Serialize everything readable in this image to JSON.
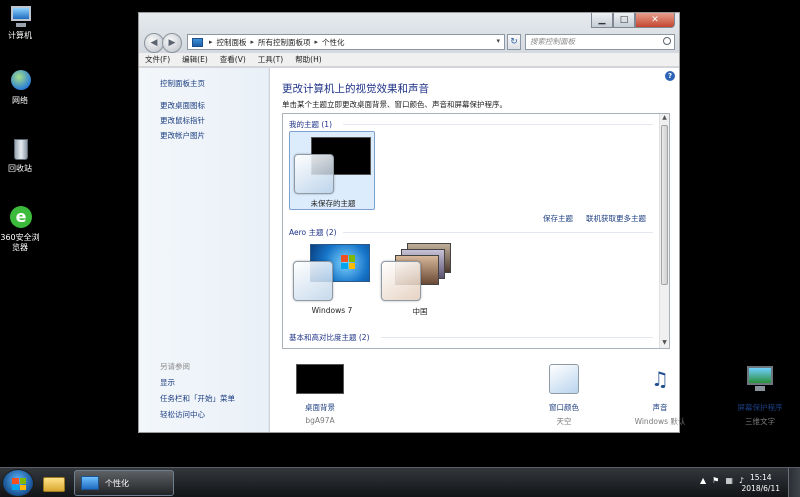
{
  "desktop": {
    "icons": [
      {
        "label": "计算机"
      },
      {
        "label": "网络"
      },
      {
        "label": "回收站"
      },
      {
        "label": "360安全浏览器"
      }
    ]
  },
  "window": {
    "address": {
      "crumbs": [
        "控制面板",
        "所有控制面板项",
        "个性化"
      ]
    },
    "search_placeholder": "搜索控制面板",
    "menu": [
      "文件(F)",
      "编辑(E)",
      "查看(V)",
      "工具(T)",
      "帮助(H)"
    ]
  },
  "left_pane": {
    "home": "控制面板主页",
    "links": [
      "更改桌面图标",
      "更改鼠标指针",
      "更改帐户图片"
    ],
    "see_also_title": "另请参阅",
    "see_also": [
      "显示",
      "任务栏和「开始」菜单",
      "轻松访问中心"
    ]
  },
  "main": {
    "heading": "更改计算机上的视觉效果和声音",
    "subtitle": "单击某个主题立即更改桌面背景、窗口颜色、声音和屏幕保护程序。",
    "groups": {
      "my_themes": "我的主题 (1)",
      "aero_themes": "Aero 主题 (2)",
      "basic_themes": "基本和高对比度主题 (2)"
    },
    "themes": {
      "unsaved": "未保存的主题",
      "windows7": "Windows 7",
      "china": "中国"
    },
    "links": {
      "save_theme": "保存主题",
      "more_online": "联机获取更多主题"
    },
    "bottom": [
      {
        "label": "桌面背景",
        "value": "bgA97A"
      },
      {
        "label": "窗口颜色",
        "value": "天空"
      },
      {
        "label": "声音",
        "value": "Windows 默认"
      },
      {
        "label": "屏幕保护程序",
        "value": "三维文字"
      }
    ]
  },
  "taskbar": {
    "task_label": "个性化",
    "time": "15:14",
    "date": "2018/6/11"
  }
}
